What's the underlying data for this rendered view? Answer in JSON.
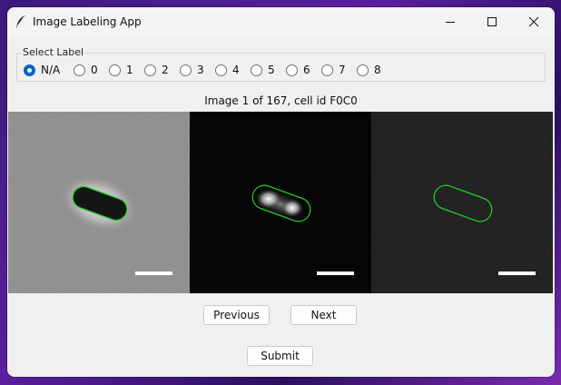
{
  "window": {
    "title": "Image Labeling App",
    "app_icon": "feather-icon"
  },
  "controls": {
    "minimize": "minimize-icon",
    "maximize": "maximize-icon",
    "close": "close-icon"
  },
  "label_group": {
    "title": "Select Label",
    "selected": "N/A",
    "options": [
      "N/A",
      "0",
      "1",
      "2",
      "3",
      "4",
      "5",
      "6",
      "7",
      "8"
    ]
  },
  "caption": "Image 1 of 167, cell id F0C0",
  "panels": [
    {
      "kind": "phase-contrast"
    },
    {
      "kind": "fluorescence"
    },
    {
      "kind": "fluorescence-dim"
    }
  ],
  "buttons": {
    "previous": "Previous",
    "next": "Next",
    "submit": "Submit"
  },
  "colors": {
    "accent": "#0067c0",
    "outline": "#22d32a",
    "scale_bar": "#ffffff"
  }
}
